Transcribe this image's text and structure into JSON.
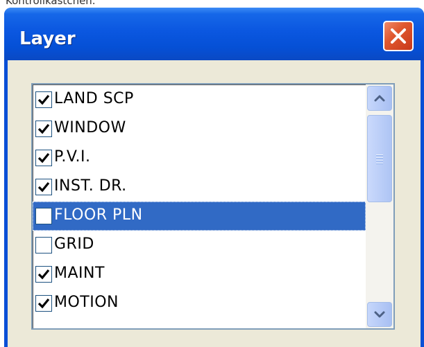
{
  "top_fragment": "Kontrollkästchen.",
  "window": {
    "title": "Layer"
  },
  "layers": [
    {
      "label": "LAND SCP",
      "checked": true,
      "selected": false
    },
    {
      "label": "WINDOW",
      "checked": true,
      "selected": false
    },
    {
      "label": "P.V.I.",
      "checked": true,
      "selected": false
    },
    {
      "label": "INST. DR.",
      "checked": true,
      "selected": false
    },
    {
      "label": "FLOOR PLN",
      "checked": false,
      "selected": true
    },
    {
      "label": "GRID",
      "checked": false,
      "selected": false
    },
    {
      "label": "MAINT",
      "checked": true,
      "selected": false
    },
    {
      "label": "MOTION",
      "checked": true,
      "selected": false
    }
  ],
  "icons": {
    "close": "close-icon",
    "scroll_up": "chevron-up-icon",
    "scroll_down": "chevron-down-icon",
    "check": "checkmark-icon"
  },
  "colors": {
    "titlebar": "#0550d6",
    "selection": "#316ac5",
    "close_button": "#e0582f",
    "client": "#ece9d8"
  }
}
